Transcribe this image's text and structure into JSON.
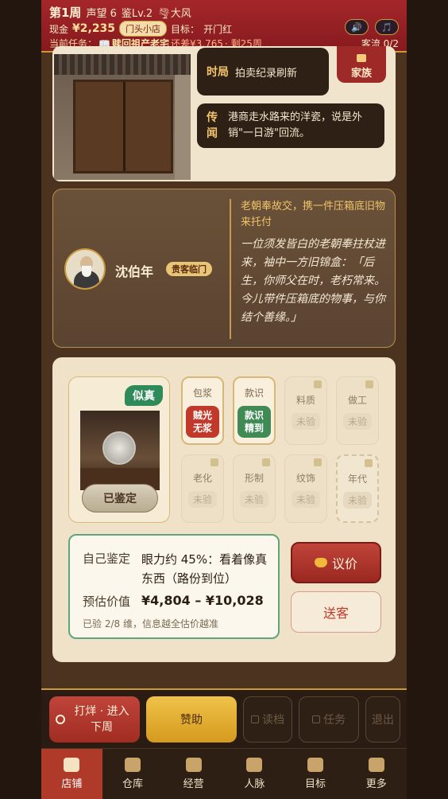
{
  "status": {
    "week": "第1周",
    "reputation": "声望 6",
    "appraisal_level": "鉴Lv.2",
    "weather": "🌪大风",
    "cash_label": "现金",
    "cash_value": "¥2,235",
    "shop_type": "门头小店",
    "goal_label": "目标：",
    "goal_value": "开门红",
    "mission_label": "当前任务：",
    "mission_icon": "📖",
    "mission_name": "赎回祖产老宅",
    "mission_gap": "还差¥3,765",
    "mission_weeks": "· 剩25周",
    "customer_flow": "客流 0/2",
    "sound_icon": "🔊",
    "music_icon": "🎵"
  },
  "scene": {
    "news": [
      {
        "tag": "时局",
        "text": "拍卖纪录刷新"
      },
      {
        "tag": "传闻",
        "text": "港商走水路来的洋瓷，说是外销\"一日游\"回流。"
      }
    ],
    "family_button": "家族"
  },
  "visitor": {
    "name": "沈伯年",
    "badge": "贵客临门",
    "summary": "老朝奉故交，携一件压箱底旧物来托付",
    "story": "一位须发皆白的老朝奉拄杖进来，袖中一方旧锦盒：「后生，你师父在时，老朽常来。今儿带件压箱底的物事，与你结个善缘。」"
  },
  "item": {
    "verdict_tag": "似真",
    "verified_button": "已鉴定",
    "dimensions": [
      {
        "label": "包浆",
        "value": "贼光无浆",
        "state": "open-red"
      },
      {
        "label": "款识",
        "value": "款识精到",
        "state": "open-green"
      },
      {
        "label": "料质",
        "value": "未验",
        "state": "locked"
      },
      {
        "label": "做工",
        "value": "未验",
        "state": "locked"
      },
      {
        "label": "老化",
        "value": "未验",
        "state": "locked"
      },
      {
        "label": "形制",
        "value": "未验",
        "state": "locked"
      },
      {
        "label": "纹饰",
        "value": "未验",
        "state": "locked"
      },
      {
        "label": "年代",
        "value": "未验",
        "state": "dashed"
      }
    ]
  },
  "assessment": {
    "self_label": "自己鉴定",
    "self_value": "眼力约 45%：看着像真东西（路份到位）",
    "estimate_label": "预估价值",
    "estimate_value": "¥4,804 – ¥10,028",
    "hint": "已验 2/8 维，信息越全估价越准"
  },
  "actions": {
    "bargain": "议价",
    "send_off": "送客",
    "next_week": "打烊 · 进入下周",
    "sponsor": "赞助",
    "load": "读档",
    "tasks": "任务",
    "quit": "退出"
  },
  "nav": [
    "店铺",
    "仓库",
    "经营",
    "人脉",
    "目标",
    "更多"
  ],
  "colors": {
    "brand_red": "#a4262a",
    "gold": "#c99a3b",
    "green_verdict": "#2f8a5a"
  }
}
